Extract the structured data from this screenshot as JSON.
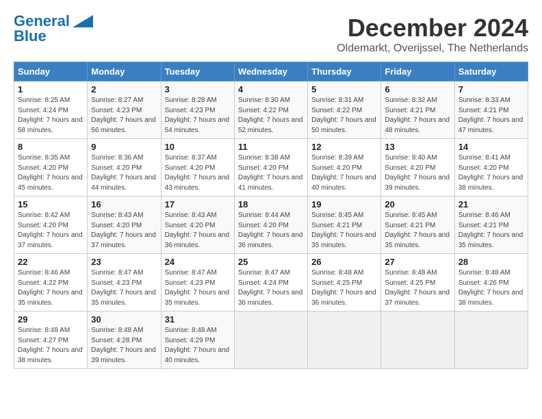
{
  "header": {
    "logo_line1": "General",
    "logo_line2": "Blue",
    "month": "December 2024",
    "location": "Oldemarkt, Overijssel, The Netherlands"
  },
  "days_of_week": [
    "Sunday",
    "Monday",
    "Tuesday",
    "Wednesday",
    "Thursday",
    "Friday",
    "Saturday"
  ],
  "weeks": [
    [
      {
        "day": "1",
        "sunrise": "8:25 AM",
        "sunset": "4:24 PM",
        "daylight": "7 hours and 58 minutes."
      },
      {
        "day": "2",
        "sunrise": "8:27 AM",
        "sunset": "4:23 PM",
        "daylight": "7 hours and 56 minutes."
      },
      {
        "day": "3",
        "sunrise": "8:28 AM",
        "sunset": "4:23 PM",
        "daylight": "7 hours and 54 minutes."
      },
      {
        "day": "4",
        "sunrise": "8:30 AM",
        "sunset": "4:22 PM",
        "daylight": "7 hours and 52 minutes."
      },
      {
        "day": "5",
        "sunrise": "8:31 AM",
        "sunset": "4:22 PM",
        "daylight": "7 hours and 50 minutes."
      },
      {
        "day": "6",
        "sunrise": "8:32 AM",
        "sunset": "4:21 PM",
        "daylight": "7 hours and 48 minutes."
      },
      {
        "day": "7",
        "sunrise": "8:33 AM",
        "sunset": "4:21 PM",
        "daylight": "7 hours and 47 minutes."
      }
    ],
    [
      {
        "day": "8",
        "sunrise": "8:35 AM",
        "sunset": "4:20 PM",
        "daylight": "7 hours and 45 minutes."
      },
      {
        "day": "9",
        "sunrise": "8:36 AM",
        "sunset": "4:20 PM",
        "daylight": "7 hours and 44 minutes."
      },
      {
        "day": "10",
        "sunrise": "8:37 AM",
        "sunset": "4:20 PM",
        "daylight": "7 hours and 43 minutes."
      },
      {
        "day": "11",
        "sunrise": "8:38 AM",
        "sunset": "4:20 PM",
        "daylight": "7 hours and 41 minutes."
      },
      {
        "day": "12",
        "sunrise": "8:39 AM",
        "sunset": "4:20 PM",
        "daylight": "7 hours and 40 minutes."
      },
      {
        "day": "13",
        "sunrise": "8:40 AM",
        "sunset": "4:20 PM",
        "daylight": "7 hours and 39 minutes."
      },
      {
        "day": "14",
        "sunrise": "8:41 AM",
        "sunset": "4:20 PM",
        "daylight": "7 hours and 38 minutes."
      }
    ],
    [
      {
        "day": "15",
        "sunrise": "8:42 AM",
        "sunset": "4:20 PM",
        "daylight": "7 hours and 37 minutes."
      },
      {
        "day": "16",
        "sunrise": "8:43 AM",
        "sunset": "4:20 PM",
        "daylight": "7 hours and 37 minutes."
      },
      {
        "day": "17",
        "sunrise": "8:43 AM",
        "sunset": "4:20 PM",
        "daylight": "7 hours and 36 minutes."
      },
      {
        "day": "18",
        "sunrise": "8:44 AM",
        "sunset": "4:20 PM",
        "daylight": "7 hours and 36 minutes."
      },
      {
        "day": "19",
        "sunrise": "8:45 AM",
        "sunset": "4:21 PM",
        "daylight": "7 hours and 35 minutes."
      },
      {
        "day": "20",
        "sunrise": "8:45 AM",
        "sunset": "4:21 PM",
        "daylight": "7 hours and 35 minutes."
      },
      {
        "day": "21",
        "sunrise": "8:46 AM",
        "sunset": "4:21 PM",
        "daylight": "7 hours and 35 minutes."
      }
    ],
    [
      {
        "day": "22",
        "sunrise": "8:46 AM",
        "sunset": "4:22 PM",
        "daylight": "7 hours and 35 minutes."
      },
      {
        "day": "23",
        "sunrise": "8:47 AM",
        "sunset": "4:23 PM",
        "daylight": "7 hours and 35 minutes."
      },
      {
        "day": "24",
        "sunrise": "8:47 AM",
        "sunset": "4:23 PM",
        "daylight": "7 hours and 35 minutes."
      },
      {
        "day": "25",
        "sunrise": "8:47 AM",
        "sunset": "4:24 PM",
        "daylight": "7 hours and 36 minutes."
      },
      {
        "day": "26",
        "sunrise": "8:48 AM",
        "sunset": "4:25 PM",
        "daylight": "7 hours and 36 minutes."
      },
      {
        "day": "27",
        "sunrise": "8:48 AM",
        "sunset": "4:25 PM",
        "daylight": "7 hours and 37 minutes."
      },
      {
        "day": "28",
        "sunrise": "8:48 AM",
        "sunset": "4:26 PM",
        "daylight": "7 hours and 38 minutes."
      }
    ],
    [
      {
        "day": "29",
        "sunrise": "8:48 AM",
        "sunset": "4:27 PM",
        "daylight": "7 hours and 38 minutes."
      },
      {
        "day": "30",
        "sunrise": "8:48 AM",
        "sunset": "4:28 PM",
        "daylight": "7 hours and 39 minutes."
      },
      {
        "day": "31",
        "sunrise": "8:48 AM",
        "sunset": "4:29 PM",
        "daylight": "7 hours and 40 minutes."
      },
      null,
      null,
      null,
      null
    ]
  ]
}
